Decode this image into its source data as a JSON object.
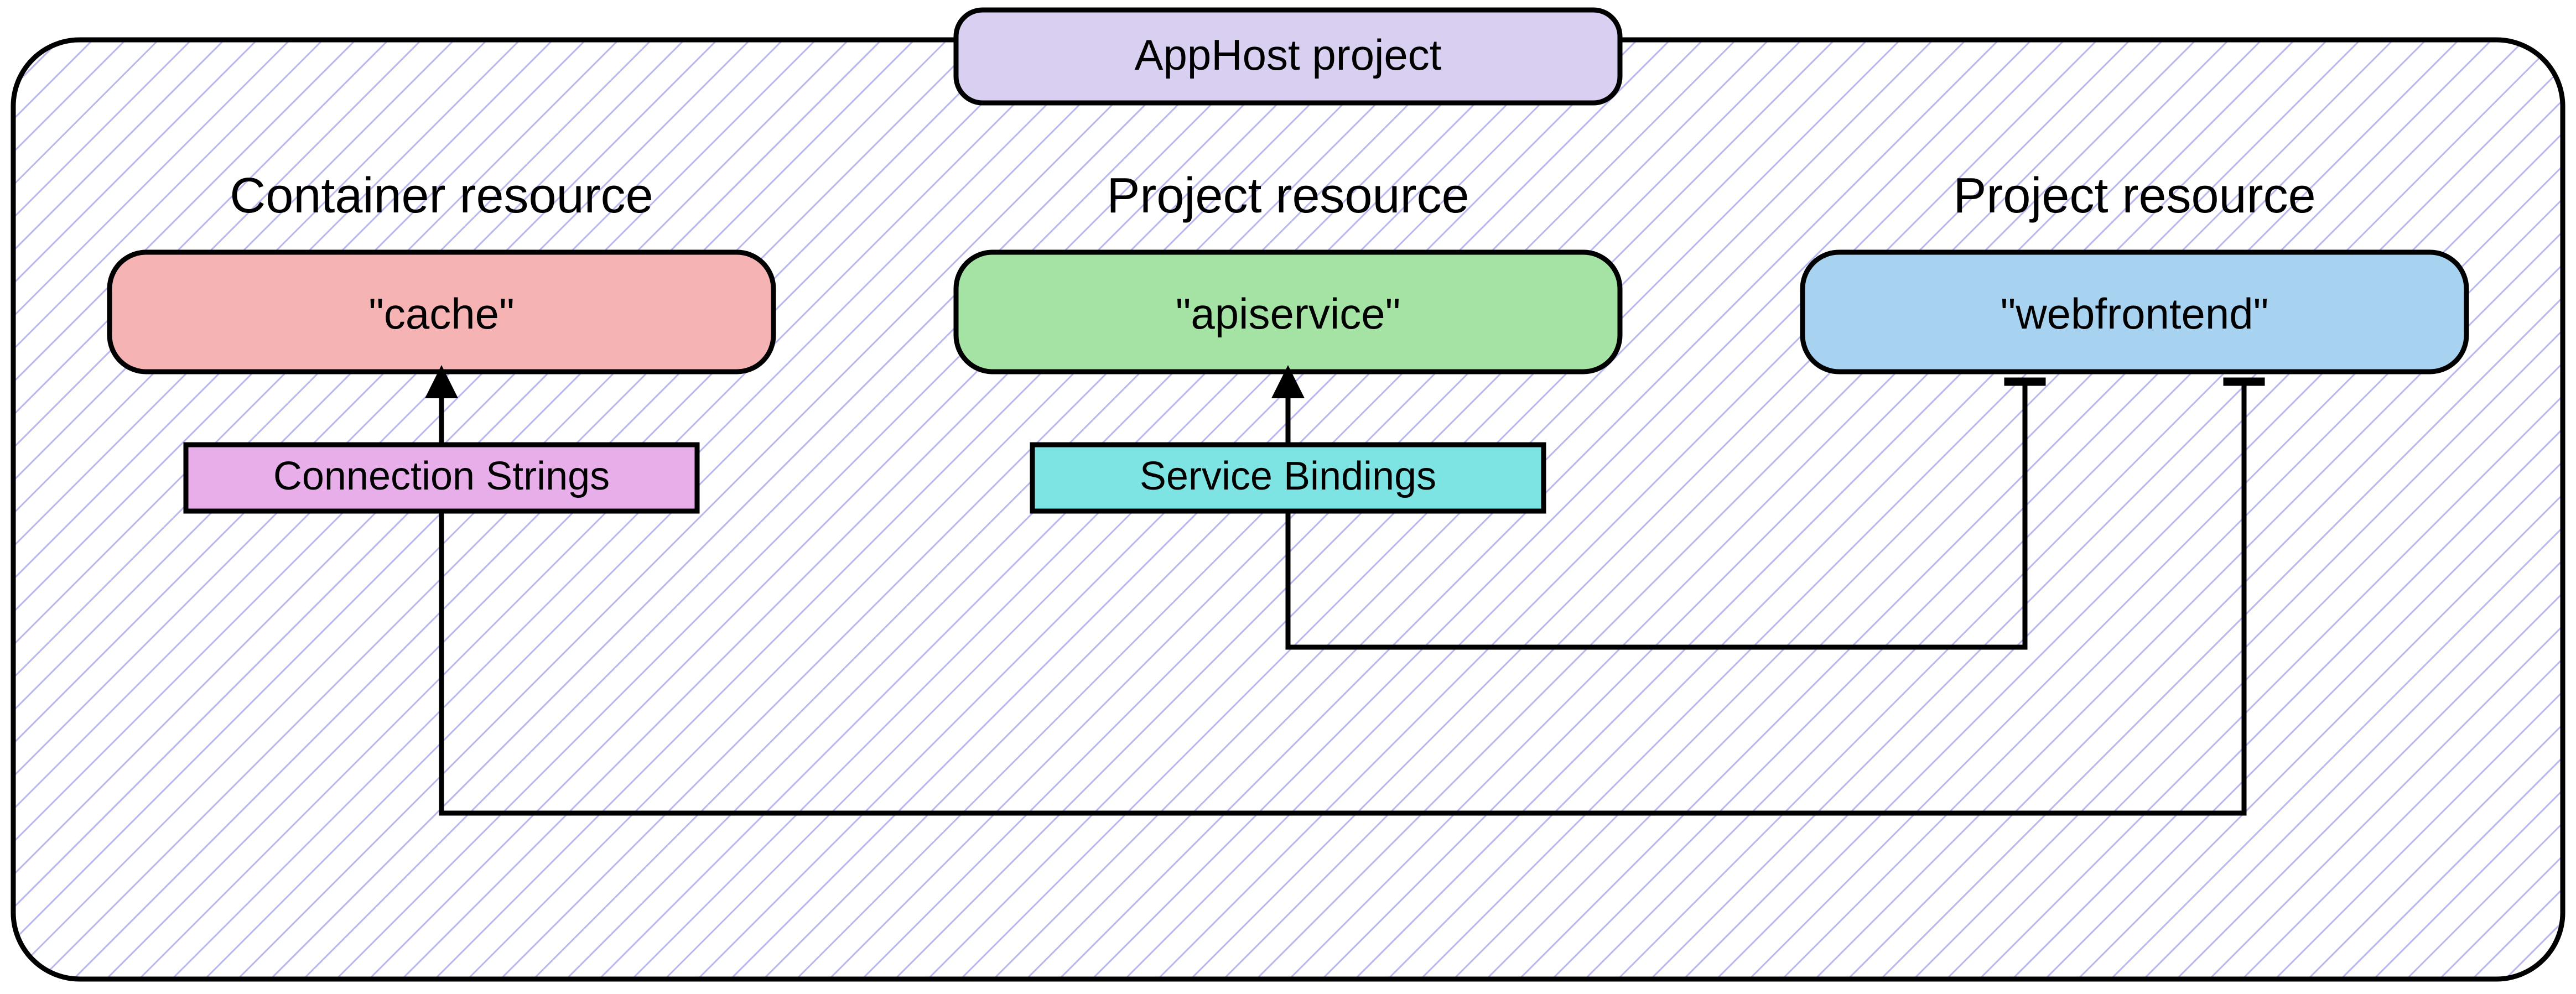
{
  "diagram": {
    "title": "AppHost project",
    "columns": [
      {
        "heading": "Container resource",
        "name": "\"cache\"",
        "fill": "#f6b3b3"
      },
      {
        "heading": "Project resource",
        "name": "\"apiservice\"",
        "fill": "#a4e3a4"
      },
      {
        "heading": "Project resource",
        "name": "\"webfrontend\"",
        "fill": "#a8d3f0"
      }
    ],
    "linkLabels": {
      "connectionStrings": "Connection Strings",
      "serviceBindings": "Service Bindings"
    },
    "colors": {
      "titleFill": "#d9cff0",
      "connFill": "#e7aeea",
      "bindFill": "#7de3e3",
      "hatch": "#b8b8f0",
      "stroke": "#000000"
    }
  }
}
